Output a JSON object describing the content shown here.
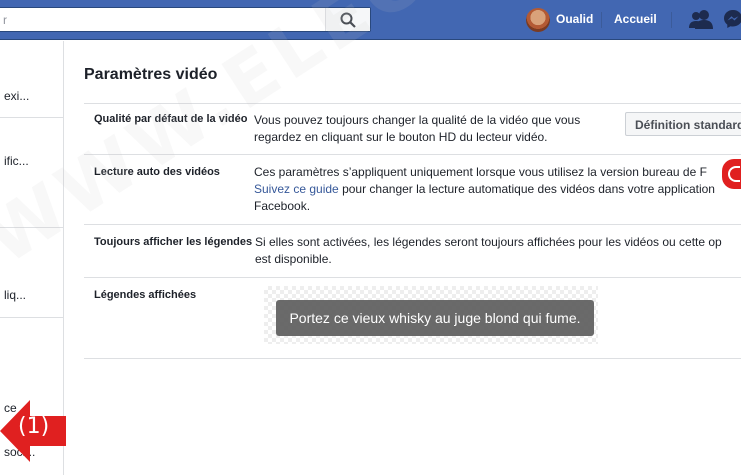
{
  "header": {
    "search_text": "r",
    "user_name": "Oualid",
    "home_label": "Accueil"
  },
  "sidebar": {
    "items": [
      {
        "label": "exi..."
      },
      {
        "label": "ific..."
      },
      {
        "label": "liq..."
      },
      {
        "label": "ce"
      },
      {
        "label": "soci..."
      }
    ]
  },
  "settings": {
    "title": "Paramètres vidéo",
    "rows": [
      {
        "label": "Qualité par défaut de la vidéo",
        "line1": "Vous pouvez toujours changer la qualité de la vidéo que vous",
        "line2": "regardez en cliquant sur le bouton HD du lecteur vidéo.",
        "button": "Définition standard"
      },
      {
        "label": "Lecture auto des vidéos",
        "line1": "Ces paramètres s’appliquent uniquement lorsque vous utilisez la version bureau de F",
        "link": "Suivez ce guide",
        "line2_rest": " pour changer la lecture automatique des vidéos dans votre application",
        "line3": "Facebook."
      },
      {
        "label": "Toujours afficher les légendes",
        "line1": "Si elles sont activées, les légendes seront toujours affichées pour les vidéos ou cette op",
        "line2": "est disponible."
      },
      {
        "label": "Légendes affichées",
        "caption_preview": "Portez ce vieux whisky au juge blond qui fume."
      }
    ]
  },
  "annotation": {
    "label": "(1)",
    "color": "#e02020"
  },
  "watermark": "WWW.ELECTROZE.CO",
  "colors": {
    "topbar": "#4267b2",
    "link": "#365899"
  }
}
